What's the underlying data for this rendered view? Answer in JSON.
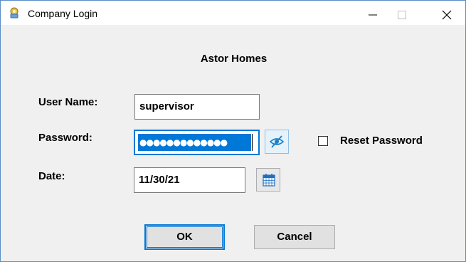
{
  "window": {
    "title": "Company Login",
    "icon": "company-login-app-icon",
    "controls": [
      "minimize-icon",
      "maximize-icon",
      "close-icon"
    ]
  },
  "company_name": "Astor Homes",
  "form": {
    "username": {
      "label": "User Name:",
      "value": "supervisor"
    },
    "password": {
      "label": "Password:",
      "masked_value": "●●●●●●●●●●●●●",
      "toggle_icon": "eye-slash-icon"
    },
    "reset_password": {
      "label": "Reset Password",
      "checked": false
    },
    "date": {
      "label": "Date:",
      "value": "11/30/21",
      "picker_icon": "calendar-icon"
    }
  },
  "buttons": {
    "ok": "OK",
    "cancel": "Cancel"
  },
  "colors": {
    "focus_border": "#0078d7",
    "selection": "#0078d7",
    "dialog_background": "#f0f0f0",
    "button_face": "#e1e1e1"
  }
}
